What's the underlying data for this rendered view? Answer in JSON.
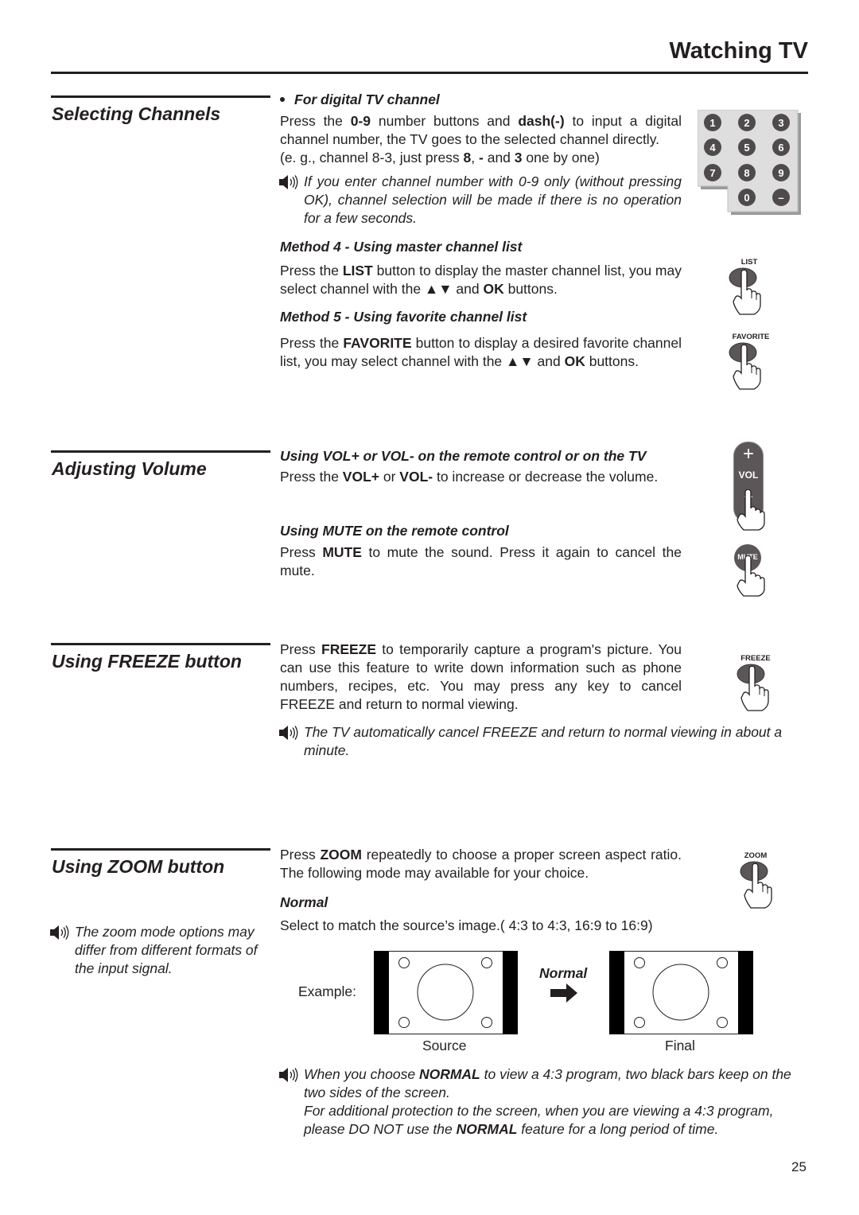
{
  "header": {
    "title": "Watching TV"
  },
  "sections": {
    "selecting_channels": {
      "title": "Selecting Channels",
      "digital": {
        "heading": "For digital TV channel",
        "p1": [
          "Press the ",
          "0-9",
          " number buttons and ",
          "dash(-)",
          " to input a digital channel number, the TV goes to the selected channel directly."
        ],
        "p2": [
          "(e. g., channel 8-3, just press ",
          "8",
          ", ",
          "-",
          " and ",
          "3",
          " one by one)"
        ],
        "note": "If you enter channel number with 0-9 only (without pressing OK), channel selection will be made if there is no operation for a few seconds.",
        "keypad_keys": [
          "1",
          "2",
          "3",
          "4",
          "5",
          "6",
          "7",
          "8",
          "9",
          "0",
          "–"
        ]
      },
      "method4": {
        "heading": "Method 4 - Using master channel list",
        "text": [
          "Press the ",
          "LIST",
          " button to display the master channel list, you may select channel with the ▲▼ and ",
          "OK",
          " buttons."
        ],
        "button_label": "LIST"
      },
      "method5": {
        "heading": "Method 5 - Using favorite channel list",
        "text": [
          "Press the ",
          "FAVORITE",
          " button to display a desired favorite channel list, you may select channel with the ▲▼ and ",
          "OK",
          " buttons."
        ],
        "button_label": "FAVORITE"
      }
    },
    "adjusting_volume": {
      "title": "Adjusting Volume",
      "vol": {
        "heading": "Using VOL+ or VOL- on the remote control or on the TV",
        "text": [
          "Press the ",
          "VOL+",
          " or ",
          "VOL-",
          " to increase or decrease the volume."
        ],
        "button_plus": "+",
        "button_label": "VOL",
        "button_minus": "–"
      },
      "mute": {
        "heading": "Using MUTE on the remote control",
        "text": [
          "Press ",
          "MUTE",
          " to mute the sound. Press it again to cancel the mute."
        ],
        "button_label": "MUTE"
      }
    },
    "freeze": {
      "title": "Using FREEZE button",
      "text": [
        "Press ",
        "FREEZE",
        " to temporarily capture a program's picture. You can use this feature to write down information such as phone numbers, recipes, etc. You may press any key to cancel FREEZE and return to normal viewing."
      ],
      "note": "The TV automatically cancel FREEZE and return to normal viewing in about a minute.",
      "button_label": "FREEZE"
    },
    "zoom": {
      "title": "Using ZOOM button",
      "side_note": "The zoom mode options may differ from different formats of the input signal.",
      "text": [
        "Press ",
        "ZOOM",
        " repeatedly to choose a proper screen aspect ratio. The following mode may available for your choice."
      ],
      "button_label": "ZOOM",
      "normal": {
        "heading": "Normal",
        "text": "Select to match the source’s image.( 4:3 to 4:3, 16:9 to 16:9)",
        "example_label": "Example:",
        "arrow_label": "Normal",
        "source_caption": "Source",
        "final_caption": "Final"
      },
      "note": {
        "l1": [
          "When you choose ",
          "NORMAL",
          " to view a 4:3 program, two black bars keep on the two sides of the screen."
        ],
        "l2": [
          "For additional protection to the screen, when you are viewing a 4:3 program, please DO NOT use the ",
          "NORMAL",
          " feature for a long period of time."
        ]
      }
    }
  },
  "footer": {
    "page_number": "25"
  }
}
